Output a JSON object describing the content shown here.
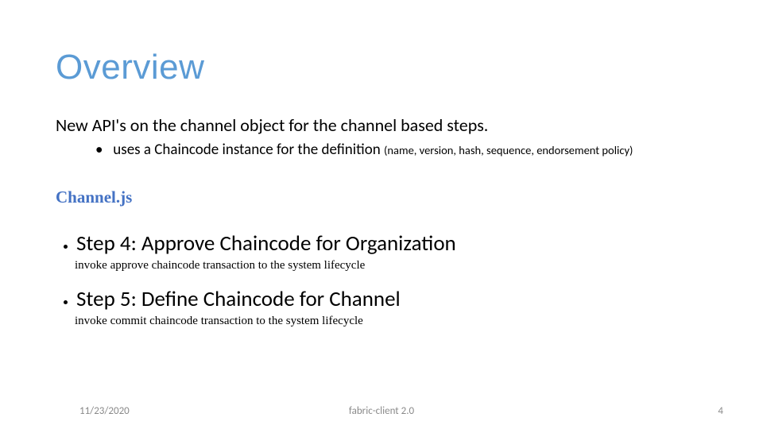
{
  "title": "Overview",
  "intro": "New API's on the channel object for the channel based steps.",
  "intro_sub": {
    "text": "uses a Chaincode instance for the definition ",
    "annot": "(name, version, hash, sequence, endorsement policy)"
  },
  "file_label": "Channel.js",
  "steps": [
    {
      "head": "Step 4: Approve Chaincode for Organization",
      "sub": "invoke approve chaincode transaction to the system lifecycle"
    },
    {
      "head": "Step 5: Define Chaincode for Channel",
      "sub": "invoke commit chaincode transaction to the system lifecycle"
    }
  ],
  "footer": {
    "date": "11/23/2020",
    "center": "fabric-client 2.0",
    "page": "4"
  }
}
